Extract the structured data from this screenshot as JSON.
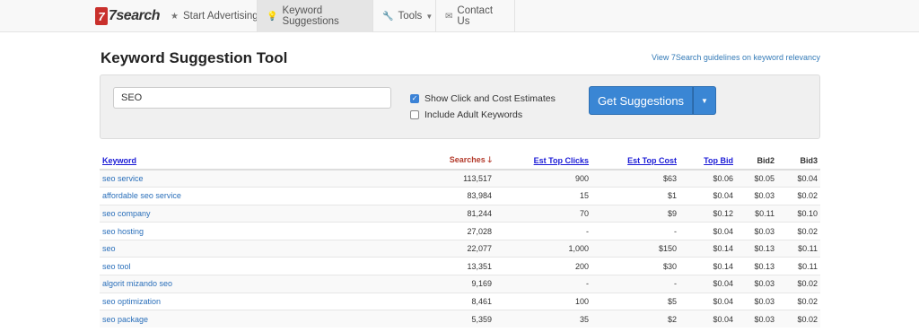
{
  "brand": {
    "mark": "7",
    "name": "7search"
  },
  "nav": [
    {
      "icon": "★",
      "label": "Start Advertising"
    },
    {
      "icon": "💡",
      "label": "Keyword Suggestions"
    },
    {
      "icon": "🔧",
      "label": "Tools"
    },
    {
      "icon": "✉",
      "label": "Contact Us"
    }
  ],
  "header": {
    "title": "Keyword Suggestion Tool",
    "guidelines_link": "View 7Search guidelines on keyword relevancy"
  },
  "search": {
    "query": "SEO",
    "show_estimates_label": "Show Click and Cost Estimates",
    "show_estimates_checked": true,
    "adult_label": "Include Adult Keywords",
    "adult_checked": false,
    "submit_label": "Get Suggestions"
  },
  "table": {
    "headers": {
      "keyword": "Keyword",
      "searches": "Searches",
      "clicks": "Est Top Clicks",
      "cost": "Est Top Cost",
      "top_bid": "Top Bid",
      "bid2": "Bid2",
      "bid3": "Bid3"
    },
    "rows": [
      {
        "keyword": "seo service",
        "searches": "113,517",
        "clicks": "900",
        "cost": "$63",
        "top_bid": "$0.06",
        "bid2": "$0.05",
        "bid3": "$0.04"
      },
      {
        "keyword": "affordable seo service",
        "searches": "83,984",
        "clicks": "15",
        "cost": "$1",
        "top_bid": "$0.04",
        "bid2": "$0.03",
        "bid3": "$0.02"
      },
      {
        "keyword": "seo company",
        "searches": "81,244",
        "clicks": "70",
        "cost": "$9",
        "top_bid": "$0.12",
        "bid2": "$0.11",
        "bid3": "$0.10"
      },
      {
        "keyword": "seo hosting",
        "searches": "27,028",
        "clicks": "-",
        "cost": "-",
        "top_bid": "$0.04",
        "bid2": "$0.03",
        "bid3": "$0.02"
      },
      {
        "keyword": "seo",
        "searches": "22,077",
        "clicks": "1,000",
        "cost": "$150",
        "top_bid": "$0.14",
        "bid2": "$0.13",
        "bid3": "$0.11"
      },
      {
        "keyword": "seo tool",
        "searches": "13,351",
        "clicks": "200",
        "cost": "$30",
        "top_bid": "$0.14",
        "bid2": "$0.13",
        "bid3": "$0.11"
      },
      {
        "keyword": "algorit mizando seo",
        "searches": "9,169",
        "clicks": "-",
        "cost": "-",
        "top_bid": "$0.04",
        "bid2": "$0.03",
        "bid3": "$0.02"
      },
      {
        "keyword": "seo optimization",
        "searches": "8,461",
        "clicks": "100",
        "cost": "$5",
        "top_bid": "$0.04",
        "bid2": "$0.03",
        "bid3": "$0.02"
      },
      {
        "keyword": "seo package",
        "searches": "5,359",
        "clicks": "35",
        "cost": "$2",
        "top_bid": "$0.04",
        "bid2": "$0.03",
        "bid3": "$0.02"
      }
    ]
  }
}
